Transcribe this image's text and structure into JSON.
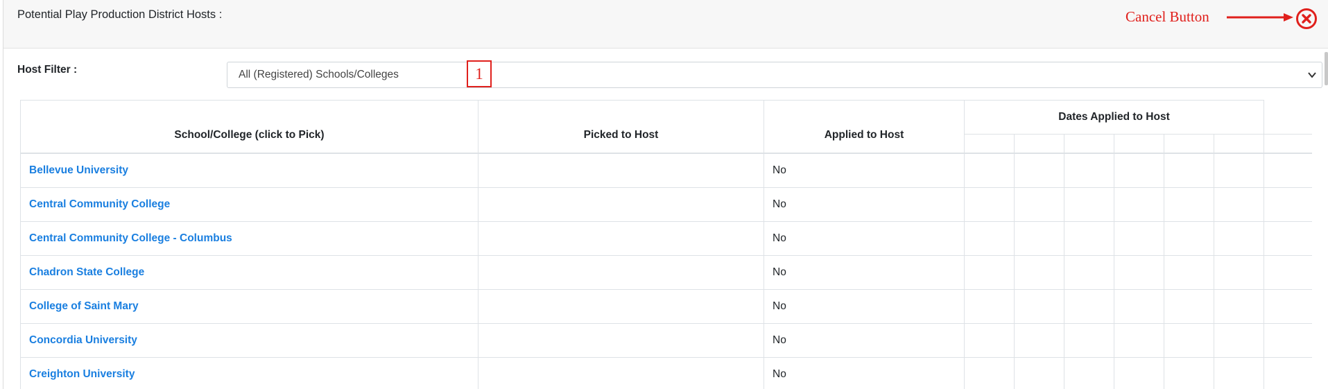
{
  "modal": {
    "title": "Potential Play Production District Hosts :",
    "close_icon": "close-circle-icon"
  },
  "annotation": {
    "cancel_label": "Cancel Button",
    "step_number": "1",
    "color": "#e0201c"
  },
  "filter": {
    "label": "Host Filter :",
    "selected": "All (Registered) Schools/Colleges",
    "icon": "chevron-down-icon"
  },
  "table": {
    "headers": {
      "school": "School/College (click to Pick)",
      "picked": "Picked to Host",
      "applied": "Applied to Host",
      "dates": "Dates Applied to Host"
    },
    "rows": [
      {
        "school": "Bellevue University",
        "picked": "",
        "applied": "No"
      },
      {
        "school": "Central Community College",
        "picked": "",
        "applied": "No"
      },
      {
        "school": "Central Community College - Columbus",
        "picked": "",
        "applied": "No"
      },
      {
        "school": "Chadron State College",
        "picked": "",
        "applied": "No"
      },
      {
        "school": "College of Saint Mary",
        "picked": "",
        "applied": "No"
      },
      {
        "school": "Concordia University",
        "picked": "",
        "applied": "No"
      },
      {
        "school": "Creighton University",
        "picked": "",
        "applied": "No"
      }
    ]
  },
  "colors": {
    "link": "#1a7fe0",
    "header_bg": "#f7f7f7"
  }
}
